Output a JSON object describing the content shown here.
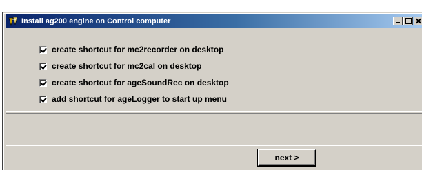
{
  "window": {
    "title": "Install ag200 engine on Control computer",
    "icon": "installer-app-icon"
  },
  "title_buttons": [
    "minimize",
    "maximize",
    "close"
  ],
  "options": [
    {
      "label": "create shortcut for mc2recorder on desktop",
      "checked": true
    },
    {
      "label": "create shortcut for mc2cal on desktop",
      "checked": true
    },
    {
      "label": "create shortcut for ageSoundRec on desktop",
      "checked": true
    },
    {
      "label": "add shortcut for ageLogger to start up menu",
      "checked": true
    }
  ],
  "footer": {
    "next_label": "next >"
  },
  "colors": {
    "title_start": "#0a246a",
    "title_end": "#a6caf0",
    "face": "#d4d0c8"
  }
}
